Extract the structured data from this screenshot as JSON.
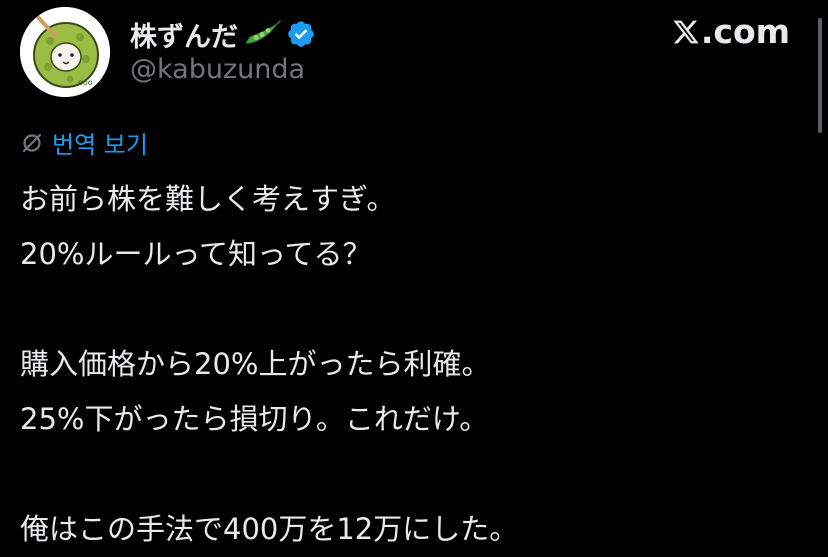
{
  "profile": {
    "display_name": "株ずんだ",
    "handle": "@kabuzunda",
    "verified": true,
    "avatar": "zunda-mochi-character-avatar",
    "name_emoji": "pea-pod-icon"
  },
  "brand": {
    "logo": "x-logo-icon",
    "suffix": ".com"
  },
  "translate": {
    "icon": "translate-icon",
    "label": "번역 보기"
  },
  "tweet": {
    "lines": [
      "お前ら株を難しく考えすぎ。",
      "20%ルールって知ってる？",
      "",
      "購入価格から20%上がったら利確。",
      "25%下がったら損切り。これだけ。",
      "",
      "俺はこの手法で400万を12万にした。"
    ]
  },
  "colors": {
    "background": "#000000",
    "text": "#e7e9ea",
    "muted": "#71767b",
    "link": "#1d9bf0",
    "verified": "#1d9bf0",
    "avatar_green": "#9bbd45"
  }
}
